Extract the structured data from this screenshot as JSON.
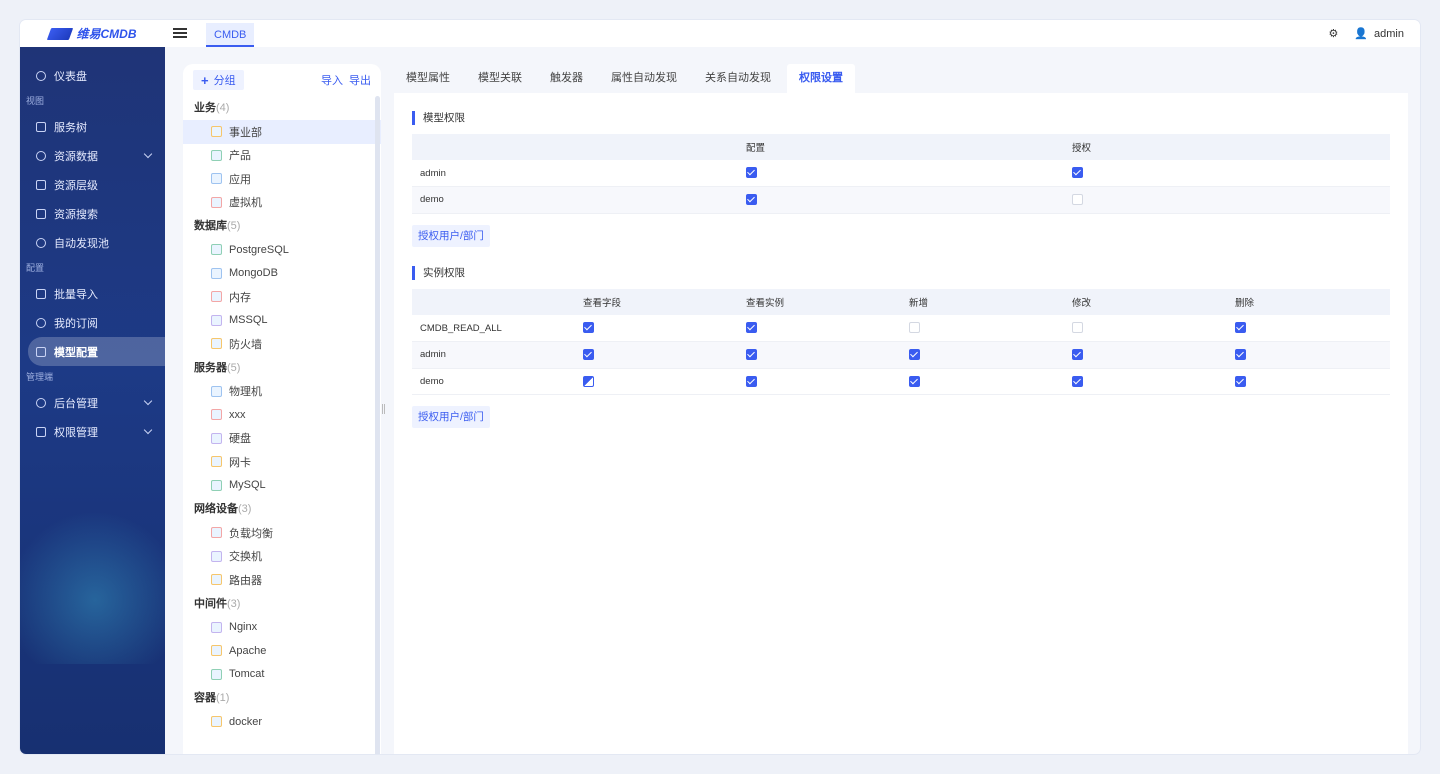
{
  "app": {
    "logo_text": "维易CMDB"
  },
  "topbar": {
    "tab": "CMDB",
    "user": "admin"
  },
  "sidebar": {
    "items": [
      {
        "label": "仪表盘",
        "type": "item",
        "icon": "dashboard-icon"
      },
      {
        "label": "视图",
        "type": "group"
      },
      {
        "label": "服务树",
        "type": "item",
        "icon": "tree-icon"
      },
      {
        "label": "资源数据",
        "type": "item",
        "icon": "database-icon",
        "chevron": true
      },
      {
        "label": "资源层级",
        "type": "item",
        "icon": "layers-icon"
      },
      {
        "label": "资源搜索",
        "type": "item",
        "icon": "search-icon"
      },
      {
        "label": "自动发现池",
        "type": "item",
        "icon": "discover-icon"
      },
      {
        "label": "配置",
        "type": "group"
      },
      {
        "label": "批量导入",
        "type": "item",
        "icon": "import-icon"
      },
      {
        "label": "我的订阅",
        "type": "item",
        "icon": "subscribe-icon"
      },
      {
        "label": "模型配置",
        "type": "item",
        "icon": "model-icon",
        "active": true
      },
      {
        "label": "管理端",
        "type": "group"
      },
      {
        "label": "后台管理",
        "type": "item",
        "icon": "gear-icon",
        "chevron": true
      },
      {
        "label": "权限管理",
        "type": "item",
        "icon": "shield-icon",
        "chevron": true
      }
    ]
  },
  "tree": {
    "add_group": "分组",
    "import": "导入",
    "export": "导出",
    "groups": [
      {
        "name": "业务",
        "count": "(4)",
        "items": [
          "事业部",
          "产品",
          "应用",
          "虚拟机"
        ]
      },
      {
        "name": "数据库",
        "count": "(5)",
        "items": [
          "PostgreSQL",
          "MongoDB",
          "内存",
          "MSSQL",
          "防火墙"
        ]
      },
      {
        "name": "服务器",
        "count": "(5)",
        "items": [
          "物理机",
          "xxx",
          "硬盘",
          "网卡",
          "MySQL"
        ]
      },
      {
        "name": "网络设备",
        "count": "(3)",
        "items": [
          "负载均衡",
          "交换机",
          "路由器"
        ]
      },
      {
        "name": "中间件",
        "count": "(3)",
        "items": [
          "Nginx",
          "Apache",
          "Tomcat"
        ]
      },
      {
        "name": "容器",
        "count": "(1)",
        "items": [
          "docker"
        ]
      }
    ],
    "selected": "事业部"
  },
  "tabs": [
    "模型属性",
    "模型关联",
    "触发器",
    "属性自动发现",
    "关系自动发现",
    "权限设置"
  ],
  "active_tab": "权限设置",
  "model_perm": {
    "title": "模型权限",
    "columns": [
      "",
      "配置",
      "授权"
    ],
    "rows": [
      {
        "name": "admin",
        "values": [
          "on",
          "on"
        ]
      },
      {
        "name": "demo",
        "values": [
          "on",
          "off"
        ]
      }
    ],
    "grant_label": "授权用户/部门"
  },
  "instance_perm": {
    "title": "实例权限",
    "columns": [
      "",
      "查看字段",
      "查看实例",
      "新增",
      "修改",
      "删除"
    ],
    "rows": [
      {
        "name": "CMDB_READ_ALL",
        "values": [
          "on",
          "on",
          "off",
          "off",
          "on"
        ]
      },
      {
        "name": "admin",
        "values": [
          "on",
          "on",
          "on",
          "on",
          "on"
        ]
      },
      {
        "name": "demo",
        "values": [
          "half",
          "on",
          "on",
          "on",
          "on"
        ]
      }
    ],
    "grant_label": "授权用户/部门"
  },
  "colors": {
    "accent": "#3a5cf0",
    "sidebar": "#1f3477"
  }
}
